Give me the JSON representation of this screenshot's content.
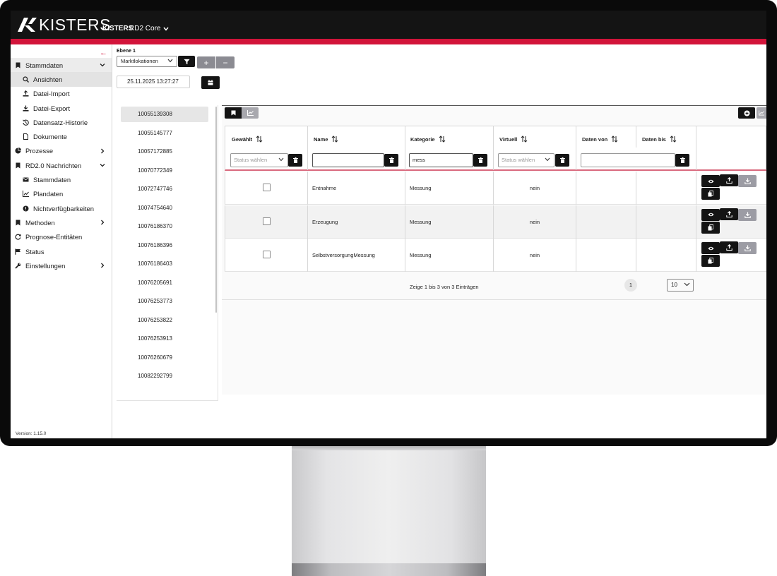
{
  "header": {
    "logo_text": "KISTERS",
    "brand": "KISTERS",
    "product": "RD2 Core"
  },
  "sidebar": {
    "version": "Version: 1.15.0",
    "items": [
      {
        "label": "Stammdaten",
        "icon": "bookmark-icon",
        "level": 1,
        "expanded": true
      },
      {
        "label": "Ansichten",
        "icon": "search-icon",
        "level": 2,
        "active": true
      },
      {
        "label": "Datei-Import",
        "icon": "upload-icon",
        "level": 2
      },
      {
        "label": "Datei-Export",
        "icon": "download-icon",
        "level": 2
      },
      {
        "label": "Datensatz-Historie",
        "icon": "history-icon",
        "level": 2
      },
      {
        "label": "Dokumente",
        "icon": "document-icon",
        "level": 2
      },
      {
        "label": "Prozesse",
        "icon": "pie-chart-icon",
        "level": 1,
        "expandable": true
      },
      {
        "label": "RD2.0 Nachrichten",
        "icon": "bookmark-icon",
        "level": 1,
        "expanded": true
      },
      {
        "label": "Stammdaten",
        "icon": "envelope-icon",
        "level": 2
      },
      {
        "label": "Plandaten",
        "icon": "line-chart-icon",
        "level": 2
      },
      {
        "label": "Nichtverfügbarkeiten",
        "icon": "alert-circle-icon",
        "level": 2
      },
      {
        "label": "Methoden",
        "icon": "bookmark-icon",
        "level": 1,
        "expandable": true
      },
      {
        "label": "Prognose-Entitäten",
        "icon": "refresh-icon",
        "level": 1
      },
      {
        "label": "Status",
        "icon": "flag-icon",
        "level": 1
      },
      {
        "label": "Einstellungen",
        "icon": "wrench-icon",
        "level": 1,
        "expandable": true
      }
    ]
  },
  "toolbar": {
    "ebene_label": "Ebene 1",
    "ebene_value": "Marktlokationen",
    "date_value": "25.11.2025 13:27:27"
  },
  "id_list": [
    "10055139308",
    "10055145777",
    "10057172885",
    "10070772349",
    "10072747746",
    "10074754640",
    "10076186370",
    "10076186396",
    "10076186403",
    "10076205691",
    "10076253773",
    "10076253822",
    "10076253913",
    "10076260679",
    "10082292799"
  ],
  "table": {
    "columns": [
      "Gewählt",
      "Name",
      "Kategorie",
      "Virtuell",
      "Daten von",
      "Daten bis"
    ],
    "filters": {
      "gewaehlt_placeholder": "Status wählen",
      "name_value": "",
      "kategorie_value": "mess",
      "virtuell_placeholder": "Status wählen",
      "daten_value": ""
    },
    "rows": [
      {
        "name": "Entnahme",
        "kategorie": "Messung",
        "virtuell": "nein",
        "daten_von": "",
        "daten_bis": ""
      },
      {
        "name": "Erzeugung",
        "kategorie": "Messung",
        "virtuell": "nein",
        "daten_von": "",
        "daten_bis": ""
      },
      {
        "name": "SelbstversorgungMessung",
        "kategorie": "Messung",
        "virtuell": "nein",
        "daten_von": "",
        "daten_bis": ""
      }
    ]
  },
  "pagination": {
    "summary": "Zeige 1 bis 3 von 3 Einträgen",
    "page": "1",
    "page_size": "10"
  },
  "colors": {
    "accent": "#d2143a",
    "dark": "#141414",
    "button_grey": "#9c9ca4"
  }
}
